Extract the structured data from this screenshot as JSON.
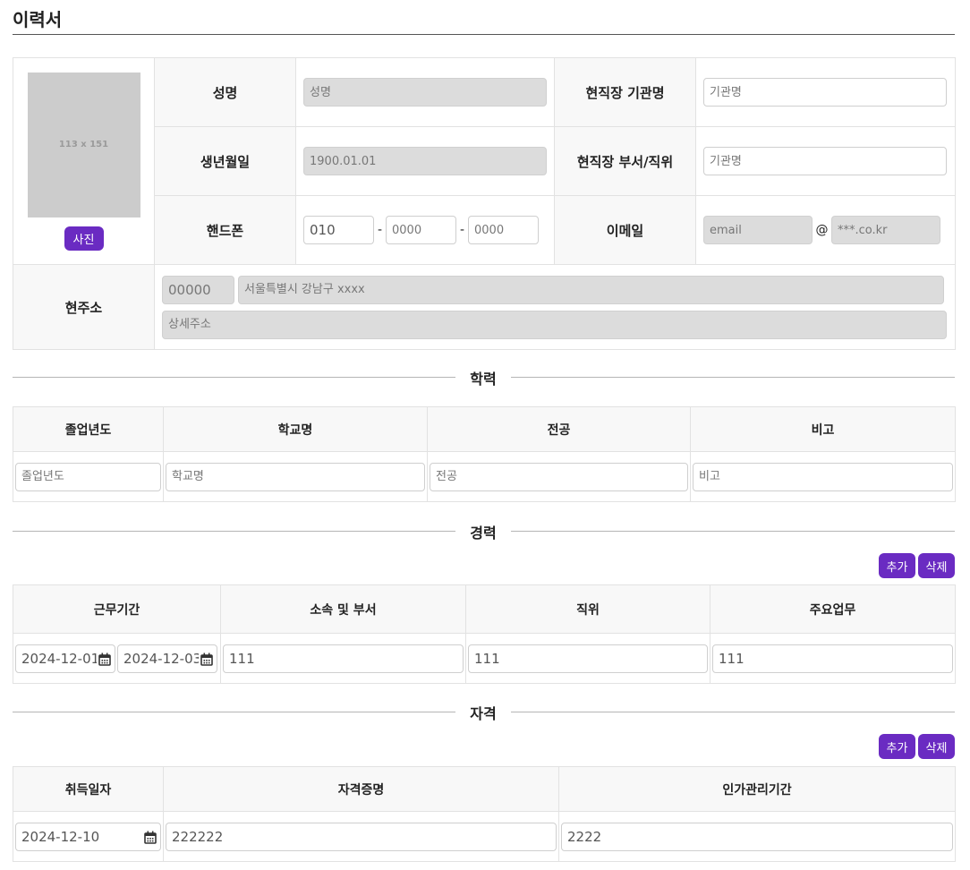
{
  "page": {
    "title": "이력서"
  },
  "profile": {
    "photo_placeholder": "113 x 151",
    "photo_button": "사진",
    "name_label": "성명",
    "name_placeholder": "성명",
    "birth_label": "생년월일",
    "birth_value": "1900.01.01",
    "phone_label": "핸드폰",
    "phone1": "010",
    "phone2_placeholder": "0000",
    "phone3_placeholder": "0000",
    "dash": "-",
    "org_label": "현직장 기관명",
    "org_placeholder": "기관명",
    "dept_label": "현직장 부서/직위",
    "dept_placeholder": "기관명",
    "email_label": "이메일",
    "email_placeholder": "email",
    "at": "@",
    "domain_placeholder": "***.co.kr",
    "address_label": "현주소",
    "zip_placeholder": "00000",
    "address_placeholder": "서울특별시 강남구 xxxx",
    "detail_placeholder": "상세주소"
  },
  "education": {
    "title": "학력",
    "headers": [
      "졸업년도",
      "학교명",
      "전공",
      "비고"
    ],
    "placeholders": [
      "졸업년도",
      "학교명",
      "전공",
      "비고"
    ]
  },
  "career": {
    "title": "경력",
    "add_label": "추가",
    "delete_label": "삭제",
    "headers": [
      "근무기간",
      "소속 및 부서",
      "직위",
      "주요업무"
    ],
    "row": {
      "start": "2024-12-01",
      "end": "2024-12-03",
      "dept": "111",
      "position": "111",
      "duty": "111"
    }
  },
  "license": {
    "title": "자격",
    "add_label": "추가",
    "delete_label": "삭제",
    "headers": [
      "취득일자",
      "자격증명",
      "인가관리기간"
    ],
    "row": {
      "date": "2024-12-10",
      "name": "222222",
      "org": "2222"
    }
  },
  "colors": {
    "accent": "#6a2bc2",
    "disabled_bg": "#dcdcdc",
    "label_bg": "#f8f8f8"
  },
  "icons": [
    "calendar-icon"
  ]
}
